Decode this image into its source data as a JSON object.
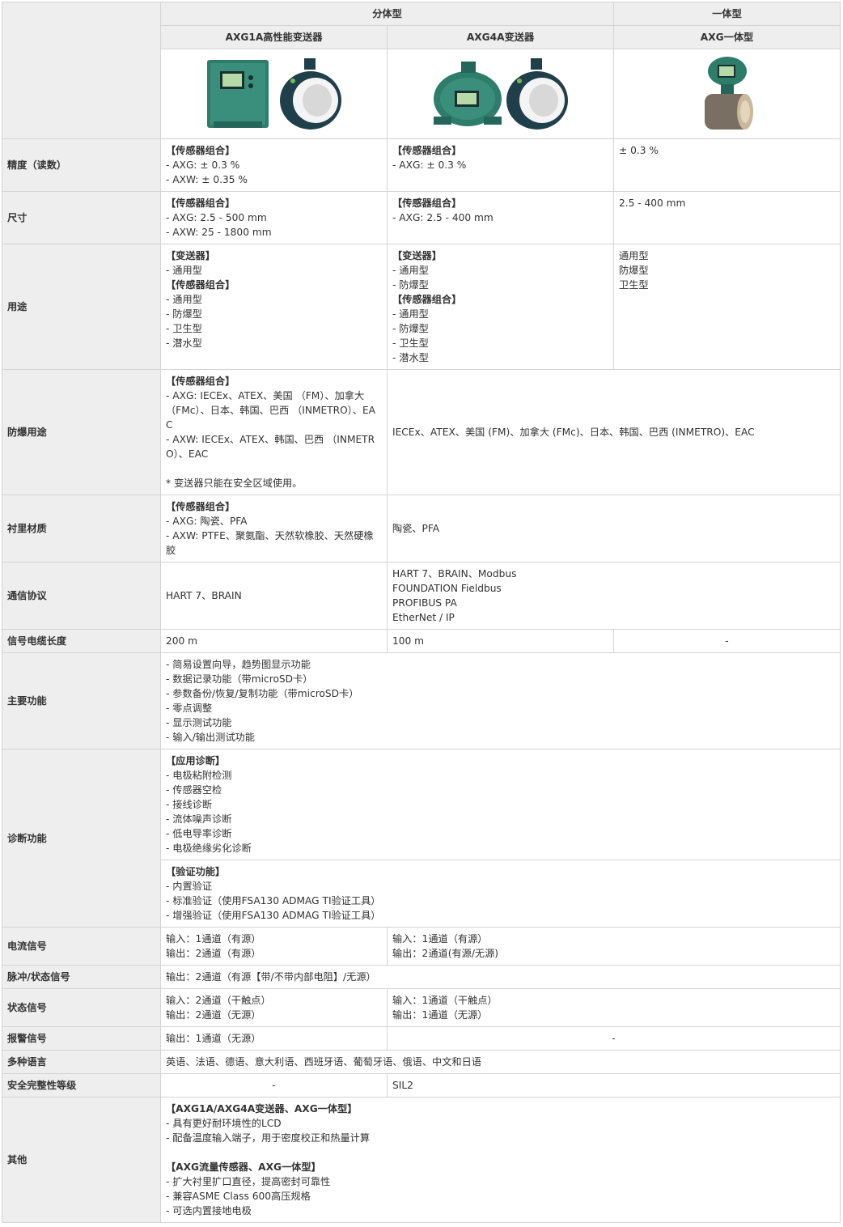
{
  "header": {
    "group_split": "分体型",
    "group_integral": "一体型",
    "col1": "AXG1A高性能变送器",
    "col2": "AXG4A变送器",
    "col3": "AXG一体型"
  },
  "rows": {
    "accuracy": {
      "label": "精度（读数）",
      "c1": [
        "【传感器组合】",
        "- AXG: ± 0.3 %",
        "- AXW: ± 0.35 %"
      ],
      "c2": [
        "【传感器组合】",
        "- AXG: ± 0.3 %"
      ],
      "c3": "± 0.3 %"
    },
    "size": {
      "label": "尺寸",
      "c1": [
        "【传感器组合】",
        "- AXG: 2.5 - 500 mm",
        "- AXW: 25 - 1800 mm"
      ],
      "c2": [
        "【传感器组合】",
        "- AXG: 2.5 - 400 mm"
      ],
      "c3": "2.5 - 400 mm"
    },
    "usage": {
      "label": "用途",
      "c1": [
        "【变送器】",
        "- 通用型",
        "【传感器组合】",
        "- 通用型",
        "- 防爆型",
        "- 卫生型",
        "- 潜水型"
      ],
      "c2": [
        "【变送器】",
        "- 通用型",
        "- 防爆型",
        "【传感器组合】",
        "- 通用型",
        "- 防爆型",
        "- 卫生型",
        "- 潜水型"
      ],
      "c3": [
        "通用型",
        "防爆型",
        "卫生型"
      ]
    },
    "explosion": {
      "label": "防爆用途",
      "c1": [
        "【传感器组合】",
        "- AXG: IECEx、ATEX、美国 （FM）、加拿大 （FMc）、日本、韩国、巴西 （INMETRO）、EAC",
        "- AXW: IECEx、ATEX、韩国、巴西 （INMETRO）、EAC",
        "",
        "* 变送器只能在安全区域使用。"
      ],
      "c23": "IECEx、ATEX、美国 (FM)、加拿大 (FMc)、日本、韩国、巴西 (INMETRO)、EAC"
    },
    "lining": {
      "label": "衬里材质",
      "c1": [
        "【传感器组合】",
        "- AXG: 陶瓷、PFA",
        "- AXW: PTFE、聚氨酯、天然软橡胶、天然硬橡胶"
      ],
      "c23": "陶瓷、PFA"
    },
    "protocol": {
      "label": "通信协议",
      "c1": "HART 7、BRAIN",
      "c23": [
        "HART 7、BRAIN、Modbus",
        "FOUNDATION Fieldbus",
        "PROFIBUS PA",
        "EtherNet / IP"
      ]
    },
    "cable": {
      "label": "信号电缆长度",
      "c1": "200 m",
      "c2": "100 m",
      "c3": "-"
    },
    "functions": {
      "label": "主要功能",
      "all": [
        "- 简易设置向导，趋势图显示功能",
        "- 数据记录功能（带microSD卡）",
        "- 参数备份/恢复/复制功能（带microSD卡）",
        "- 零点调整",
        "- 显示测试功能",
        "- 输入/输出测试功能"
      ]
    },
    "diagnostics": {
      "label": "诊断功能",
      "part1": [
        "【应用诊断】",
        "- 电极粘附检测",
        "- 传感器空检",
        "- 接线诊断",
        "- 流体噪声诊断",
        "- 低电导率诊断",
        "- 电极绝缘劣化诊断"
      ],
      "part2": [
        "【验证功能】",
        "- 内置验证",
        "- 标准验证（使用FSA130 ADMAG TI验证工具）",
        "- 增强验证（使用FSA130 ADMAG TI验证工具）"
      ]
    },
    "current": {
      "label": "电流信号",
      "c1": [
        "输入：1通道（有源）",
        "输出：2通道（有源）"
      ],
      "c23": [
        "输入：1通道（有源）",
        "输出：2通道(有源/无源)"
      ]
    },
    "pulse": {
      "label": "脉冲/状态信号",
      "all": "输出：2通道（有源【带/不带内部电阻】/无源）"
    },
    "status": {
      "label": "状态信号",
      "c1": [
        "输入：2通道（干触点）",
        "输出：2通道（无源）"
      ],
      "c23": [
        "输入：1通道（干触点）",
        "输出：1通道（无源）"
      ]
    },
    "alarm": {
      "label": "报警信号",
      "c1": "输出：1通道（无源）",
      "c23": "-"
    },
    "languages": {
      "label": "多种语言",
      "all": "英语、法语、德语、意大利语、西班牙语、葡萄牙语、俄语、中文和日语"
    },
    "sil": {
      "label": "安全完整性等级",
      "c1": "-",
      "c23": "SIL2"
    },
    "other": {
      "label": "其他",
      "all": [
        "【AXG1A/AXG4A变送器、AXG一体型】",
        "- 具有更好耐环境性的LCD",
        "- 配备温度输入端子，用于密度校正和热量计算",
        "",
        "【AXG流量传感器、AXG一体型】",
        "- 扩大衬里扩口直径，提高密封可靠性",
        "- 兼容ASME Class 600高压规格",
        "- 可选内置接地电极"
      ]
    }
  },
  "colors": {
    "label_bg": "#eeeeee",
    "border": "#d4d4d4",
    "product_green": "#2e7d6b",
    "flange_dark": "#1f3f4a",
    "liner_white": "#f4f4f4",
    "ceramic": "#c9b89a"
  },
  "images": [
    "axg1a-transmitter-with-sensor",
    "axg4a-transmitter-with-sensor",
    "axg-integral-flowmeter"
  ]
}
